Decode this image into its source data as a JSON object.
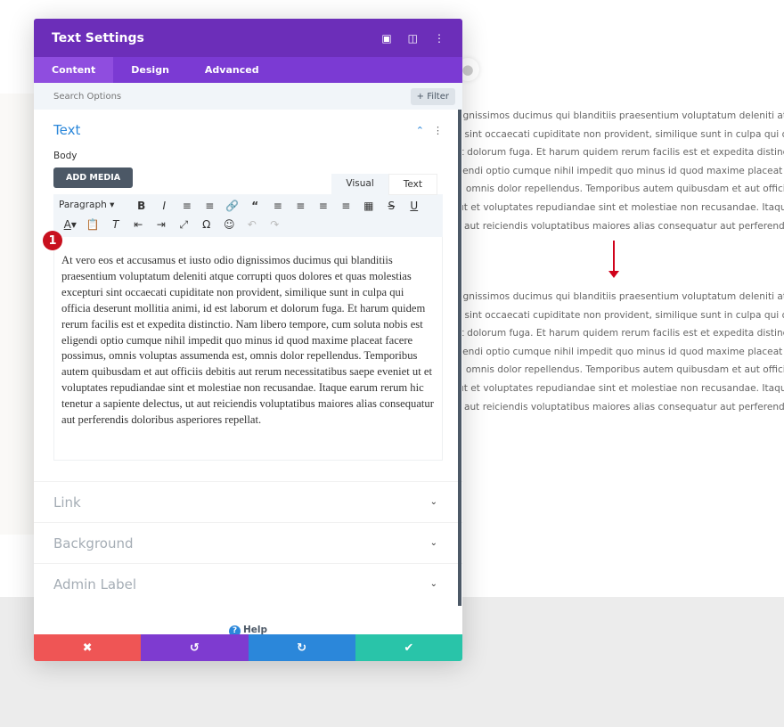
{
  "background_text": {
    "lines": [
      "o dignissimos ducimus qui blanditiis praesentium voluptatum deleniti atque",
      "turi sint occaecati cupiditate non provident, similique sunt in culpa qui offi",
      "n et dolorum fuga. Et harum quidem rerum facilis est et expedita distinctio",
      "eligendi optio cumque nihil impedit quo minus id quod maxime placeat fac",
      "est, omnis dolor repellendus. Temporibus autem quibusdam et aut officii",
      "et ut et voluptates repudiandae sint et molestiae non recusandae. Itaque e",
      ", ut aut reiciendis voluptatibus maiores alias consequatur aut perferendis d"
    ]
  },
  "modal": {
    "title": "Text Settings",
    "header_icons": [
      "focus-icon",
      "split-view-icon",
      "more-icon"
    ],
    "tabs": [
      {
        "label": "Content",
        "active": true
      },
      {
        "label": "Design"
      },
      {
        "label": "Advanced"
      }
    ],
    "search_placeholder": "Search Options",
    "filter_label": "+ Filter",
    "text_section": {
      "title": "Text",
      "body_label": "Body",
      "add_media": "ADD MEDIA",
      "visual_tab": "Visual",
      "text_tab": "Text",
      "format_select": "Paragraph",
      "badge": "1",
      "content": "At vero eos et accusamus et iusto odio dignissimos ducimus qui blanditiis praesentium voluptatum deleniti atque corrupti quos dolores et quas molestias excepturi sint occaecati cupiditate non provident, similique sunt in culpa qui officia deserunt mollitia animi, id est laborum et dolorum fuga. Et harum quidem rerum facilis est et expedita distinctio. Nam libero tempore, cum soluta nobis est eligendi optio cumque nihil impedit quo minus id quod maxime placeat facere possimus, omnis voluptas assumenda est, omnis dolor repellendus. Temporibus autem quibusdam et aut officiis debitis aut rerum necessitatibus saepe eveniet ut et voluptates repudiandae sint et molestiae non recusandae. Itaque earum rerum hic tenetur a sapiente delectus, ut aut reiciendis voluptatibus maiores alias consequatur aut perferendis doloribus asperiores repellat."
    },
    "sections": [
      "Link",
      "Background",
      "Admin Label"
    ],
    "help": "Help",
    "footer_colors": {
      "cancel": "#ef5555",
      "undo": "#7e3bd0",
      "redo": "#2b87da",
      "save": "#29c4a9"
    },
    "accent": "#6c2eb9"
  }
}
